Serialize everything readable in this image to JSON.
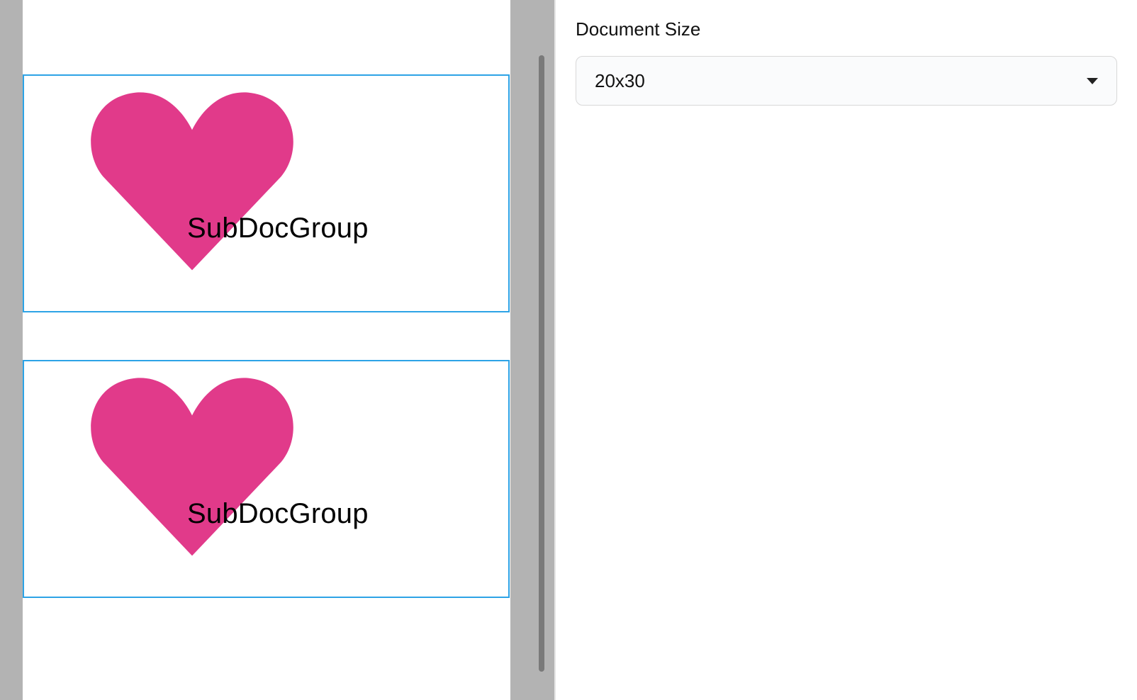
{
  "panel": {
    "documentSize": {
      "label": "Document Size",
      "value": "20x30"
    }
  },
  "canvas": {
    "heartColor": "#e13a8a",
    "subdocs": [
      {
        "label": "SubDocGroup"
      },
      {
        "label": "SubDocGroup"
      }
    ]
  }
}
